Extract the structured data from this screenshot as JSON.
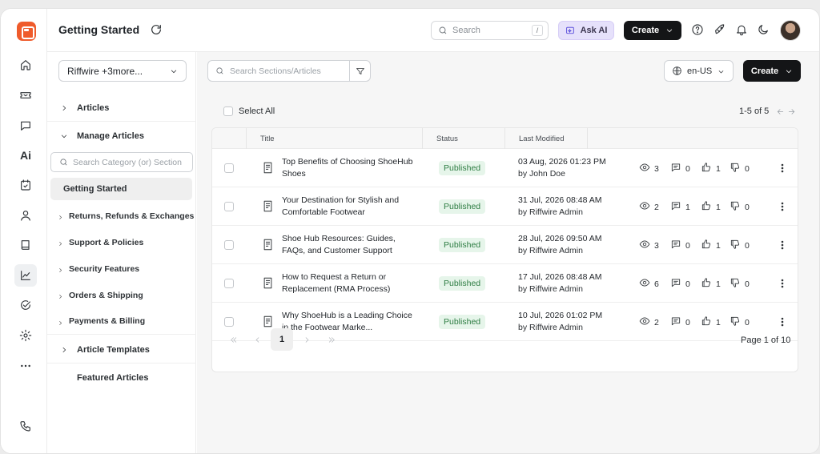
{
  "header": {
    "title": "Getting Started",
    "search_placeholder": "Search",
    "search_shortcut": "/",
    "ask_ai_label": "Ask AI",
    "create_label": "Create"
  },
  "panel": {
    "workspace_select": "Riffwire +3more...",
    "tree": [
      {
        "label": "Articles",
        "expanded": false
      },
      {
        "label": "Manage Articles",
        "expanded": true
      }
    ],
    "category_search_placeholder": "Search Category (or) Section",
    "active_category": "Getting Started",
    "categories": [
      "Returns, Refunds & Exchanges",
      "Support & Policies",
      "Security Features",
      "Orders & Shipping",
      "Payments & Billing"
    ],
    "article_templates": "Article Templates",
    "featured_articles": "Featured Articles"
  },
  "main": {
    "search_placeholder": "Search Sections/Articles",
    "language": "en-US",
    "create_label": "Create",
    "select_all_label": "Select All",
    "range_label": "1-5 of 5",
    "columns": [
      "Title",
      "Status",
      "Last Modified"
    ],
    "rows": [
      {
        "title": "Top Benefits of Choosing ShoeHub Shoes",
        "status": "Published",
        "date": "03 Aug, 2026 01:23 PM",
        "by": "by John Doe",
        "views": "3",
        "comments": "0",
        "likes": "1",
        "dislikes": "0"
      },
      {
        "title": "Your Destination for Stylish and Comfortable Footwear",
        "status": "Published",
        "date": "31 Jul, 2026 08:48 AM",
        "by": "by Riffwire Admin",
        "views": "2",
        "comments": "1",
        "likes": "1",
        "dislikes": "0"
      },
      {
        "title": "Shoe Hub Resources: Guides, FAQs, and Customer Support",
        "status": "Published",
        "date": "28 Jul, 2026 09:50 AM",
        "by": "by Riffwire Admin",
        "views": "3",
        "comments": "0",
        "likes": "1",
        "dislikes": "0"
      },
      {
        "title": "How to Request a Return or Replacement (RMA Process)",
        "status": "Published",
        "date": "17 Jul, 2026 08:48 AM",
        "by": "by Riffwire Admin",
        "views": "6",
        "comments": "0",
        "likes": "1",
        "dislikes": "0"
      },
      {
        "title": "Why ShoeHub is a Leading Choice in the Footwear Marke...",
        "status": "Published",
        "date": "10 Jul, 2026 01:02 PM",
        "by": "by Riffwire Admin",
        "views": "2",
        "comments": "0",
        "likes": "1",
        "dislikes": "0"
      }
    ],
    "current_page": "1",
    "page_label": "Page 1 of 10"
  },
  "colors": {
    "brand": "#ef5b2b",
    "primary_button": "#141517",
    "published_bg": "#e6f5ea",
    "published_text": "#2e7d43",
    "ask_ai_bg": "#e6e1fb"
  },
  "icons": {
    "rail": [
      "home-icon",
      "ticket-icon",
      "chat-icon",
      "ai-icon",
      "calendar-check-icon",
      "user-icon",
      "book-icon",
      "analytics-icon",
      "check-circle-icon",
      "settings-icon",
      "more-icon",
      "phone-icon"
    ]
  }
}
